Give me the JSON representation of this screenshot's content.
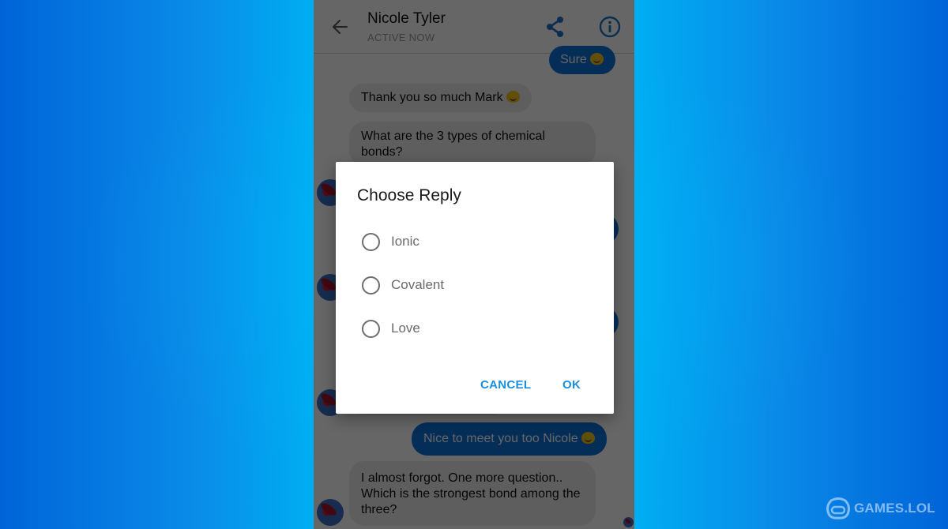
{
  "header": {
    "contact_name": "Nicole Tyler",
    "contact_status": "ACTIVE NOW",
    "icons": {
      "back": "arrow-left-icon",
      "share": "share-icon",
      "info": "info-icon"
    },
    "accent_color": "#1a73c8"
  },
  "messages": [
    {
      "from": "me",
      "text": "Sure",
      "emoji": "smiley"
    },
    {
      "from": "contact",
      "text": "Thank you so much Mark",
      "emoji": "smiling-eyes"
    },
    {
      "from": "contact",
      "text": "What are the 3 types of chemical bonds?",
      "emoji": null
    },
    {
      "from": "me",
      "text": "Nice to meet you too Nicole",
      "emoji": "smiley"
    },
    {
      "from": "contact",
      "text": "I almost forgot. One more question.. Which is the strongest bond among the three?",
      "emoji": null
    }
  ],
  "dialog": {
    "title": "Choose Reply",
    "options": [
      {
        "label": "Ionic",
        "selected": false
      },
      {
        "label": "Covalent",
        "selected": false
      },
      {
        "label": "Love",
        "selected": false
      }
    ],
    "cancel_label": "CANCEL",
    "ok_label": "OK",
    "button_color": "#1a8fe0"
  },
  "watermark": {
    "text": "GAMES.LOL",
    "icon": "gamepad-logo-icon"
  },
  "colors": {
    "outgoing_bubble": "#0a74dc",
    "incoming_bubble": "#ebebeb",
    "background_gradient": [
      "#0064d8",
      "#00aef2"
    ]
  }
}
